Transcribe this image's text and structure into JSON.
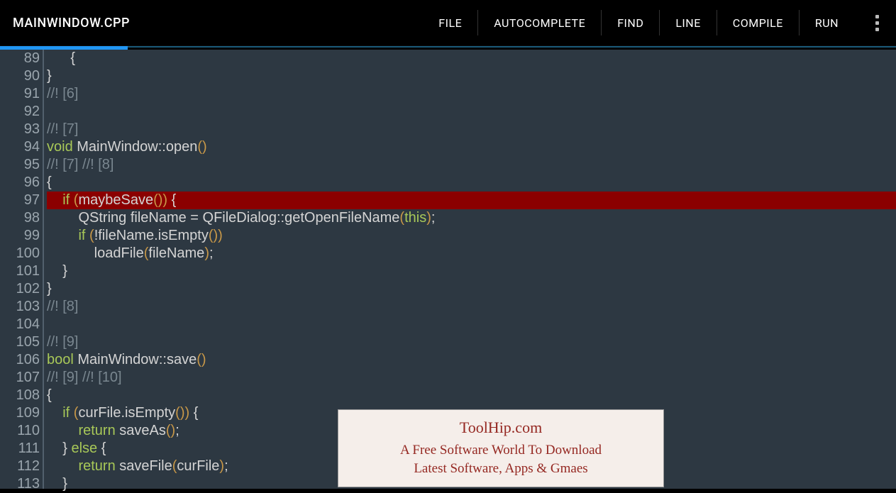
{
  "header": {
    "filename": "MAINWINDOW.CPP",
    "menu": [
      "FILE",
      "AUTOCOMPLETE",
      "FIND",
      "LINE",
      "COMPILE",
      "RUN"
    ]
  },
  "code": {
    "startLine": 89,
    "breakpointLine": 97,
    "highlightLine": 97,
    "lines": [
      {
        "n": 89,
        "tokens": [
          {
            "t": "      ",
            "c": ""
          },
          {
            "t": "{",
            "c": "brace"
          }
        ]
      },
      {
        "n": 90,
        "tokens": [
          {
            "t": "}",
            "c": "brace"
          }
        ]
      },
      {
        "n": 91,
        "tokens": [
          {
            "t": "//! [6]",
            "c": "comment"
          }
        ]
      },
      {
        "n": 92,
        "tokens": []
      },
      {
        "n": 93,
        "tokens": [
          {
            "t": "//! [7]",
            "c": "comment"
          }
        ]
      },
      {
        "n": 94,
        "tokens": [
          {
            "t": "void",
            "c": "keyword"
          },
          {
            "t": " MainWindow::open",
            "c": "text"
          },
          {
            "t": "()",
            "c": "paren"
          }
        ]
      },
      {
        "n": 95,
        "tokens": [
          {
            "t": "//! [7] //! [8]",
            "c": "comment"
          }
        ]
      },
      {
        "n": 96,
        "tokens": [
          {
            "t": "{",
            "c": "brace"
          }
        ]
      },
      {
        "n": 97,
        "tokens": [
          {
            "t": "    ",
            "c": ""
          },
          {
            "t": "if",
            "c": "keyword"
          },
          {
            "t": " ",
            "c": ""
          },
          {
            "t": "(",
            "c": "paren"
          },
          {
            "t": "maybeSave",
            "c": "text"
          },
          {
            "t": "()",
            "c": "paren"
          },
          {
            "t": ")",
            "c": "paren"
          },
          {
            "t": " ",
            "c": ""
          },
          {
            "t": "{",
            "c": "brace"
          }
        ]
      },
      {
        "n": 98,
        "tokens": [
          {
            "t": "        QString fileName = QFileDialog::getOpenFileName",
            "c": "text"
          },
          {
            "t": "(",
            "c": "paren"
          },
          {
            "t": "this",
            "c": "keyword"
          },
          {
            "t": ")",
            "c": "paren"
          },
          {
            "t": ";",
            "c": "text"
          }
        ]
      },
      {
        "n": 99,
        "tokens": [
          {
            "t": "        ",
            "c": ""
          },
          {
            "t": "if",
            "c": "keyword"
          },
          {
            "t": " ",
            "c": ""
          },
          {
            "t": "(",
            "c": "paren"
          },
          {
            "t": "!fileName.isEmpty",
            "c": "text"
          },
          {
            "t": "()",
            "c": "paren"
          },
          {
            "t": ")",
            "c": "paren"
          }
        ]
      },
      {
        "n": 100,
        "tokens": [
          {
            "t": "            loadFile",
            "c": "text"
          },
          {
            "t": "(",
            "c": "paren"
          },
          {
            "t": "fileName",
            "c": "text"
          },
          {
            "t": ")",
            "c": "paren"
          },
          {
            "t": ";",
            "c": "text"
          }
        ]
      },
      {
        "n": 101,
        "tokens": [
          {
            "t": "    ",
            "c": ""
          },
          {
            "t": "}",
            "c": "brace"
          }
        ]
      },
      {
        "n": 102,
        "tokens": [
          {
            "t": "}",
            "c": "brace"
          }
        ]
      },
      {
        "n": 103,
        "tokens": [
          {
            "t": "//! [8]",
            "c": "comment"
          }
        ]
      },
      {
        "n": 104,
        "tokens": []
      },
      {
        "n": 105,
        "tokens": [
          {
            "t": "//! [9]",
            "c": "comment"
          }
        ]
      },
      {
        "n": 106,
        "tokens": [
          {
            "t": "bool",
            "c": "keyword"
          },
          {
            "t": " MainWindow::save",
            "c": "text"
          },
          {
            "t": "()",
            "c": "paren"
          }
        ]
      },
      {
        "n": 107,
        "tokens": [
          {
            "t": "//! [9] //! [10]",
            "c": "comment"
          }
        ]
      },
      {
        "n": 108,
        "tokens": [
          {
            "t": "{",
            "c": "brace"
          }
        ]
      },
      {
        "n": 109,
        "tokens": [
          {
            "t": "    ",
            "c": ""
          },
          {
            "t": "if",
            "c": "keyword"
          },
          {
            "t": " ",
            "c": ""
          },
          {
            "t": "(",
            "c": "paren"
          },
          {
            "t": "curFile.isEmpty",
            "c": "text"
          },
          {
            "t": "()",
            "c": "paren"
          },
          {
            "t": ")",
            "c": "paren"
          },
          {
            "t": " ",
            "c": ""
          },
          {
            "t": "{",
            "c": "brace"
          }
        ]
      },
      {
        "n": 110,
        "tokens": [
          {
            "t": "        ",
            "c": ""
          },
          {
            "t": "return",
            "c": "keyword"
          },
          {
            "t": " saveAs",
            "c": "text"
          },
          {
            "t": "()",
            "c": "paren"
          },
          {
            "t": ";",
            "c": "text"
          }
        ]
      },
      {
        "n": 111,
        "tokens": [
          {
            "t": "    ",
            "c": ""
          },
          {
            "t": "}",
            "c": "brace"
          },
          {
            "t": " ",
            "c": ""
          },
          {
            "t": "else",
            "c": "keyword"
          },
          {
            "t": " ",
            "c": ""
          },
          {
            "t": "{",
            "c": "brace"
          }
        ]
      },
      {
        "n": 112,
        "tokens": [
          {
            "t": "        ",
            "c": ""
          },
          {
            "t": "return",
            "c": "keyword"
          },
          {
            "t": " saveFile",
            "c": "text"
          },
          {
            "t": "(",
            "c": "paren"
          },
          {
            "t": "curFile",
            "c": "text"
          },
          {
            "t": ")",
            "c": "paren"
          },
          {
            "t": ";",
            "c": "text"
          }
        ]
      },
      {
        "n": 113,
        "tokens": [
          {
            "t": "    ",
            "c": ""
          },
          {
            "t": "}",
            "c": "brace"
          }
        ]
      }
    ]
  },
  "watermark": {
    "title": "ToolHip.com",
    "line1": "A Free Software World To Download",
    "line2": "Latest Software, Apps & Gmaes"
  }
}
